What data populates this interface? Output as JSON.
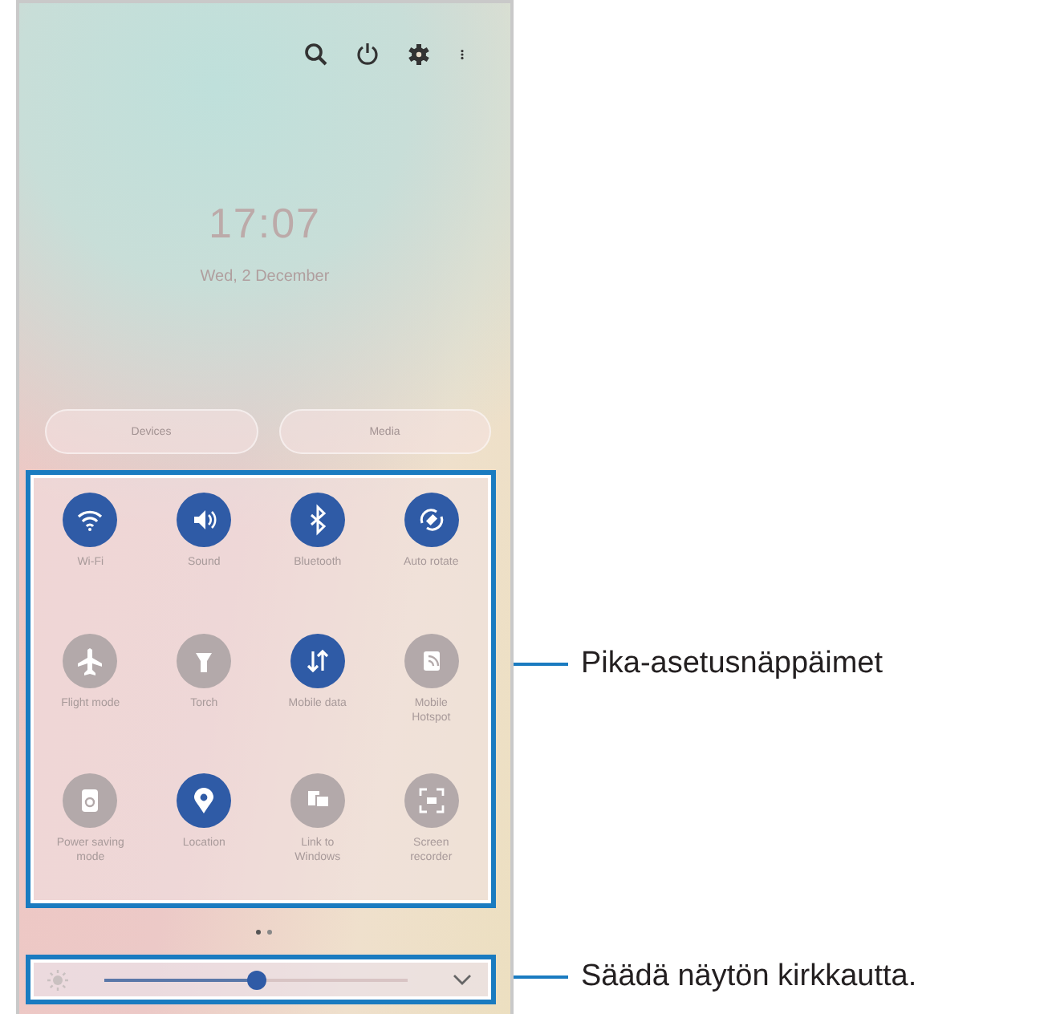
{
  "lock_info": {
    "time": "17:07",
    "date": "Wed, 2 December"
  },
  "shortcuts": [
    "Devices",
    "Media"
  ],
  "quick_settings": {
    "tiles": [
      {
        "label": "Wi-Fi",
        "on": true
      },
      {
        "label": "Sound",
        "on": true
      },
      {
        "label": "Bluetooth",
        "on": true
      },
      {
        "label": "Auto rotate",
        "on": true
      },
      {
        "label": "Flight mode",
        "on": false
      },
      {
        "label": "Torch",
        "on": false
      },
      {
        "label": "Mobile data",
        "on": true
      },
      {
        "label": "Mobile Hotspot",
        "on": false
      },
      {
        "label": "Power saving mode",
        "on": false
      },
      {
        "label": "Location",
        "on": true
      },
      {
        "label": "Link to Windows",
        "on": false
      },
      {
        "label": "Screen recorder",
        "on": false
      }
    ]
  },
  "brightness": {
    "level": 0.5
  },
  "annotations": [
    {
      "text": "Pika-asetusnäppäimet"
    },
    {
      "text": "Säädä näytön kirkkautta."
    }
  ]
}
